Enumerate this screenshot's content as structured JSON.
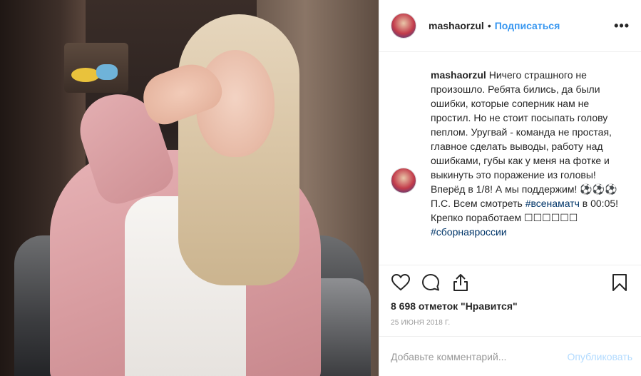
{
  "photo": {
    "description_icon": "post-photo"
  },
  "header": {
    "username": "mashaorzul",
    "separator": "•",
    "follow_label": "Подписаться",
    "more_label": "•••"
  },
  "caption": {
    "username": "mashaorzul",
    "text_part1": "Ничего страшного не произошло. Ребята бились, да были ошибки, которые соперник нам не простил. Но не стоит посыпать голову пеплом. Уругвай - команда не простая, главное сделать выводы, работу над ошибками, губы как у меня на фотке и выкинуть это поражение из головы! Вперёд в 1/8! А мы поддержим! ⚽⚽⚽ П.С. Всем смотреть ",
    "hashtag1": "#всенаматч",
    "text_part2": " в 00:05! Крепко поработаем ☐☐☐☐☐☐",
    "hashtag2": "#сборнаяроссии"
  },
  "actions": {
    "like_icon": "heart-icon",
    "comment_icon": "comment-icon",
    "share_icon": "share-icon",
    "save_icon": "bookmark-icon"
  },
  "likes": {
    "text": "8 698 отметок \"Нравится\""
  },
  "date": {
    "text": "25 ИЮНЯ 2018 Г."
  },
  "comment": {
    "placeholder": "Добавьте комментарий...",
    "publish_label": "Опубликовать"
  },
  "colors": {
    "accent": "#3897f0",
    "hashtag": "#003569",
    "publish_disabled": "#b3dbff",
    "border": "#efefef"
  }
}
